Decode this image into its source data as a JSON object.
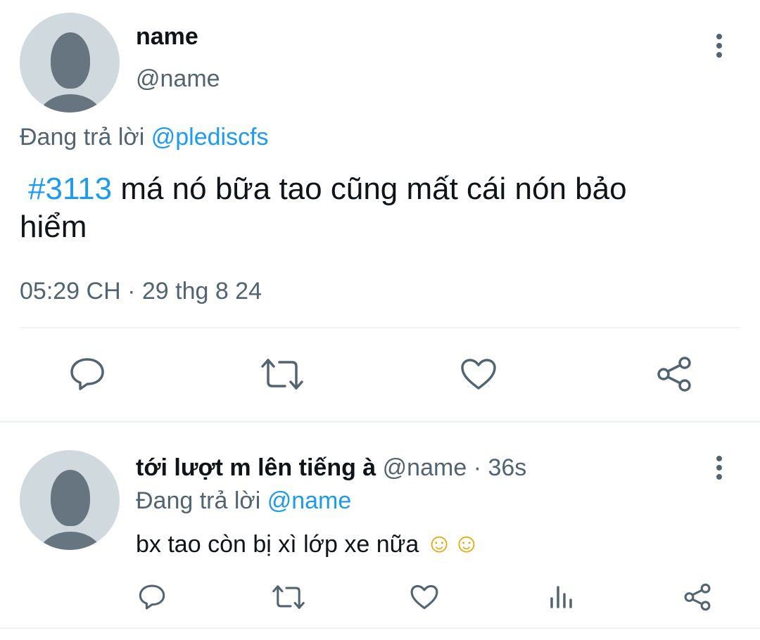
{
  "main_tweet": {
    "display_name": "name",
    "handle": "@name",
    "replying_prefix": "Đang trả lời",
    "replying_to": "@plediscfs",
    "hashtag": "#3113",
    "text_line1": " má nó bữa tao cũng mất cái nón bảo",
    "text_line2": "hiểm",
    "timestamp": "05:29 CH · 29 thg 8 24"
  },
  "reply": {
    "display_name": "tới lượt m lên tiếng à",
    "handle": "@name",
    "separator": "·",
    "time": "36s",
    "replying_prefix": "Đang trả lời",
    "replying_to": "@name",
    "text": "bx tao còn bị xì lớp xe nữa",
    "emoji": "☺☺"
  },
  "icons": {
    "more": "more-vertical-icon",
    "reply": "reply-bubble-icon",
    "retweet": "retweet-icon",
    "like": "heart-icon",
    "share": "share-icon",
    "views": "bar-chart-icon"
  },
  "colors": {
    "accent": "#1d9bf0",
    "secondary_text": "#536471",
    "icon": "#536471",
    "divider": "#eff3f4",
    "avatar_bg": "#cfd9de",
    "avatar_fg": "#66757f"
  }
}
